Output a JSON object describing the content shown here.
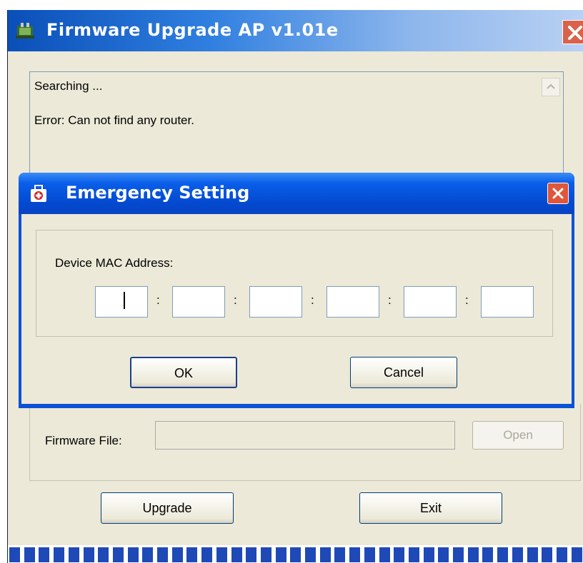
{
  "main_window": {
    "title": "Firmware Upgrade AP v1.01e",
    "log_lines": [
      "Searching ...",
      "Error: Can not find any router."
    ],
    "firmware_label": "Firmware File:",
    "firmware_value": "",
    "open_label": "Open",
    "upgrade_label": "Upgrade",
    "exit_label": "Exit"
  },
  "dialog": {
    "title": "Emergency Setting",
    "mac_label": "Device MAC Address:",
    "mac_fields": [
      "",
      "",
      "",
      "",
      "",
      ""
    ],
    "separator": ":",
    "ok_label": "OK",
    "cancel_label": "Cancel"
  },
  "colors": {
    "title_blue": "#0a4fb8",
    "dialog_blue": "#0b52d5",
    "close_red": "#e0563a",
    "window_bg": "#ece9d8",
    "progress_blue": "#1f49b7"
  },
  "progress": {
    "fraction": 1.0
  }
}
